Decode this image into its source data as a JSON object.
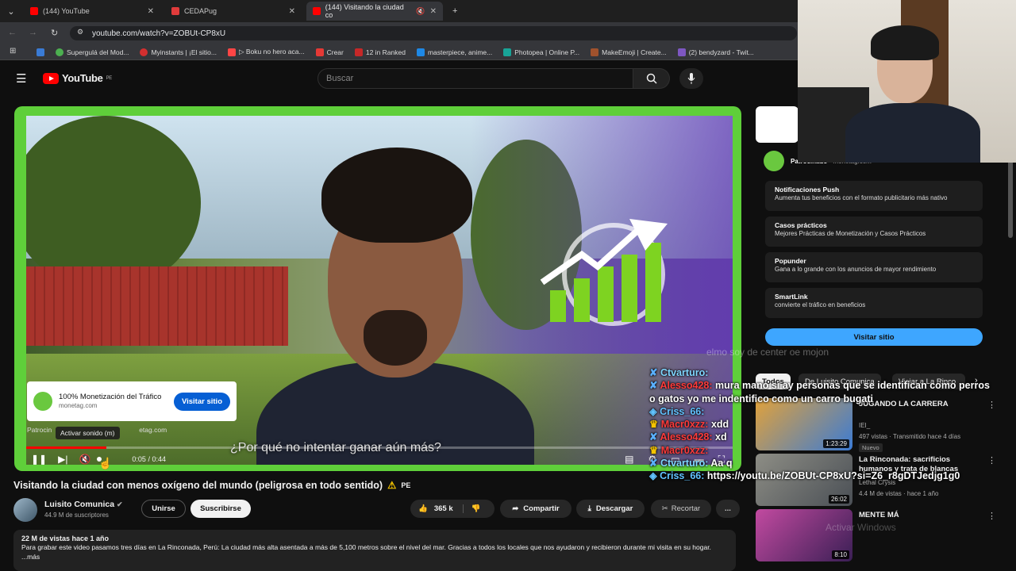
{
  "browser": {
    "tabs": [
      {
        "title": "(144) YouTube",
        "color": "#ff0000"
      },
      {
        "title": "CEDAPug",
        "color": "#e03b3b"
      },
      {
        "title": "(144) Visitando la ciudad co",
        "color": "#ff0000"
      }
    ],
    "url": "youtube.com/watch?v=ZOBUt-CP8xU",
    "bookmarks": [
      "Supergulá del Mod...",
      "Myinstants | ¡El sitio...",
      "▷ Boku no hero aca...",
      "Crear",
      "12 in Ranked",
      "masterpiece, anime...",
      "Photopea | Online P...",
      "MakeEmoji | Create...",
      "(2) bendyzard - Twit..."
    ]
  },
  "masthead": {
    "brand": "YouTube",
    "country": "PE",
    "search_placeholder": "Buscar"
  },
  "player": {
    "ad": {
      "title": "100% Monetización del Tráfico",
      "domain": "monetag.com",
      "button": "Visitar sitio",
      "sponsor_prefix": "Patrocin",
      "sponsor_suffix": "etag.com"
    },
    "tooltip": "Activar sonido (m)",
    "subtitle": "¿Por qué no intentar ganar aún más?",
    "time": "0:05 / 0:44",
    "progress": 0.114
  },
  "video": {
    "title": "Visitando la ciudad con menos oxígeno del mundo (peligrosa en todo sentido)",
    "country_badge": "PE",
    "channel": "Luisito Comunica",
    "subscribers": "44.9 M de suscriptores",
    "join": "Unirse",
    "subscribe": "Suscribirse",
    "likes": "365 k",
    "share": "Compartir",
    "download": "Descargar",
    "clip": "Recortar",
    "more": "...",
    "views_date": "22 M de vistas  hace 1 año",
    "description": "Para grabar este video pasamos tres días en La Rinconada, Perú: La ciudad más alta asentada a más de 5,100 metros sobre el nivel del mar. Gracias a todos los locales que nos ayudaron y recibieron durante mi visita en su hogar.",
    "desc_more": "...más"
  },
  "side_ad": {
    "sponsor_label": "Patrocinado",
    "domain": "· monetag.com",
    "rows": [
      {
        "title": "Notificaciones Push",
        "text": "Aumenta tus beneficios con el formato publicitario más nativo"
      },
      {
        "title": "Casos prácticos",
        "text": "Mejores Prácticas de Monetización y Casos Prácticos"
      },
      {
        "title": "Popunder",
        "text": "Gana a lo grande con los anuncios de mayor rendimiento"
      },
      {
        "title": "SmartLink",
        "text": "convierte el tráfico en beneficios"
      }
    ],
    "button": "Visitar sitio"
  },
  "chat": {
    "ghost": "elmo soy de center oe mojon",
    "messages": [
      {
        "user": "Ctvarturo:",
        "text": ""
      },
      {
        "user": "Alesso428:",
        "text": "mura mano si ay personas que se identifican como perros o gatos yo me indentifico como un carro bugati"
      },
      {
        "user": "Criss_66:",
        "text": ""
      },
      {
        "user": "Macr0xzz:",
        "text": "xdd"
      },
      {
        "user": "Alesso428:",
        "text": "xd"
      },
      {
        "user": "Macr0xzz:",
        "text": ""
      },
      {
        "user": "Ctvarturo:",
        "text": "Aa q"
      },
      {
        "user": "Criss_66:",
        "text": "https://youtu.be/ZOBUt-CP8xU?si=Z6_r8gDTJedjg1g0"
      }
    ]
  },
  "chips": [
    "Todos",
    "De Luisito Comunica",
    "Viajar a La Rinco"
  ],
  "suggestions": [
    {
      "title": "JUGANDO LA CARRERA",
      "channel": "IEI_",
      "meta": "497 vistas · Transmitido hace 4 días",
      "badge": "Nuevo",
      "duration": "1:23:29",
      "c1": "#e2a23a",
      "c2": "#3b7bd4"
    },
    {
      "title": "La Rinconada: sacrificios humanos y trata de blancas",
      "channel": "Lethal Crysis",
      "meta": "4.4 M de vistas · hace 1 año",
      "badge": "",
      "duration": "26:02",
      "c1": "#8d8d85",
      "c2": "#4a4f55"
    },
    {
      "title": "MENTE MÁ",
      "channel": "",
      "meta": "",
      "badge": "",
      "duration": "8:10",
      "c1": "#c24aa0",
      "c2": "#3a1f55"
    }
  ],
  "watermark": "Activar Windows"
}
